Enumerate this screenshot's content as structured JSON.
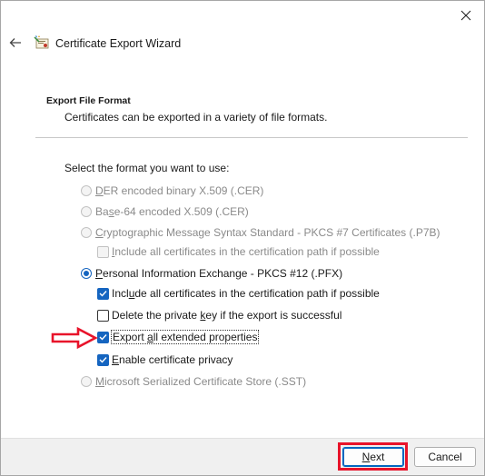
{
  "window": {
    "title": "Certificate Export Wizard",
    "icons": {
      "close": "close-icon",
      "back": "back-arrow-icon",
      "app": "certificate-wizard-icon"
    }
  },
  "section": {
    "heading": "Export File Format",
    "description": "Certificates can be exported in a variety of file formats."
  },
  "prompt": "Select the format you want to use:",
  "options": {
    "der": {
      "mnemonic": "D",
      "rest": "ER encoded binary X.509 (.CER)"
    },
    "base64": {
      "pre": "Ba",
      "mnemonic": "s",
      "rest": "e-64 encoded X.509 (.CER)"
    },
    "pkcs7": {
      "mnemonic": "C",
      "rest": "ryptographic Message Syntax Standard - PKCS #7 Certificates (.P7B)"
    },
    "pkcs7_include": {
      "mnemonic": "I",
      "rest": "nclude all certificates in the certification path if possible"
    },
    "pfx": {
      "mnemonic": "P",
      "rest": "ersonal Information Exchange - PKCS #12 (.PFX)"
    },
    "pfx_include": {
      "pre": "Incl",
      "mnemonic": "u",
      "rest": "de all certificates in the certification path if possible"
    },
    "delete_key": {
      "pre": "Delete the private ",
      "mnemonic": "k",
      "rest": "ey if the export is successful"
    },
    "export_ext": {
      "pre": "Export ",
      "mnemonic": "a",
      "rest": "ll extended properties"
    },
    "privacy": {
      "mnemonic": "E",
      "rest": "nable certificate privacy"
    },
    "sst": {
      "mnemonic": "M",
      "rest": "icrosoft Serialized Certificate Store (.SST)"
    }
  },
  "state": {
    "selected_format": "pfx",
    "pkcs7_include": false,
    "pfx_include": true,
    "delete_key": false,
    "export_ext": true,
    "privacy": true
  },
  "buttons": {
    "next": {
      "mnemonic": "N",
      "rest": "ext"
    },
    "cancel": "Cancel"
  },
  "colors": {
    "accent": "#1565c0",
    "annotation_red": "#e8132a",
    "disabled_text": "#8a8a8a"
  }
}
